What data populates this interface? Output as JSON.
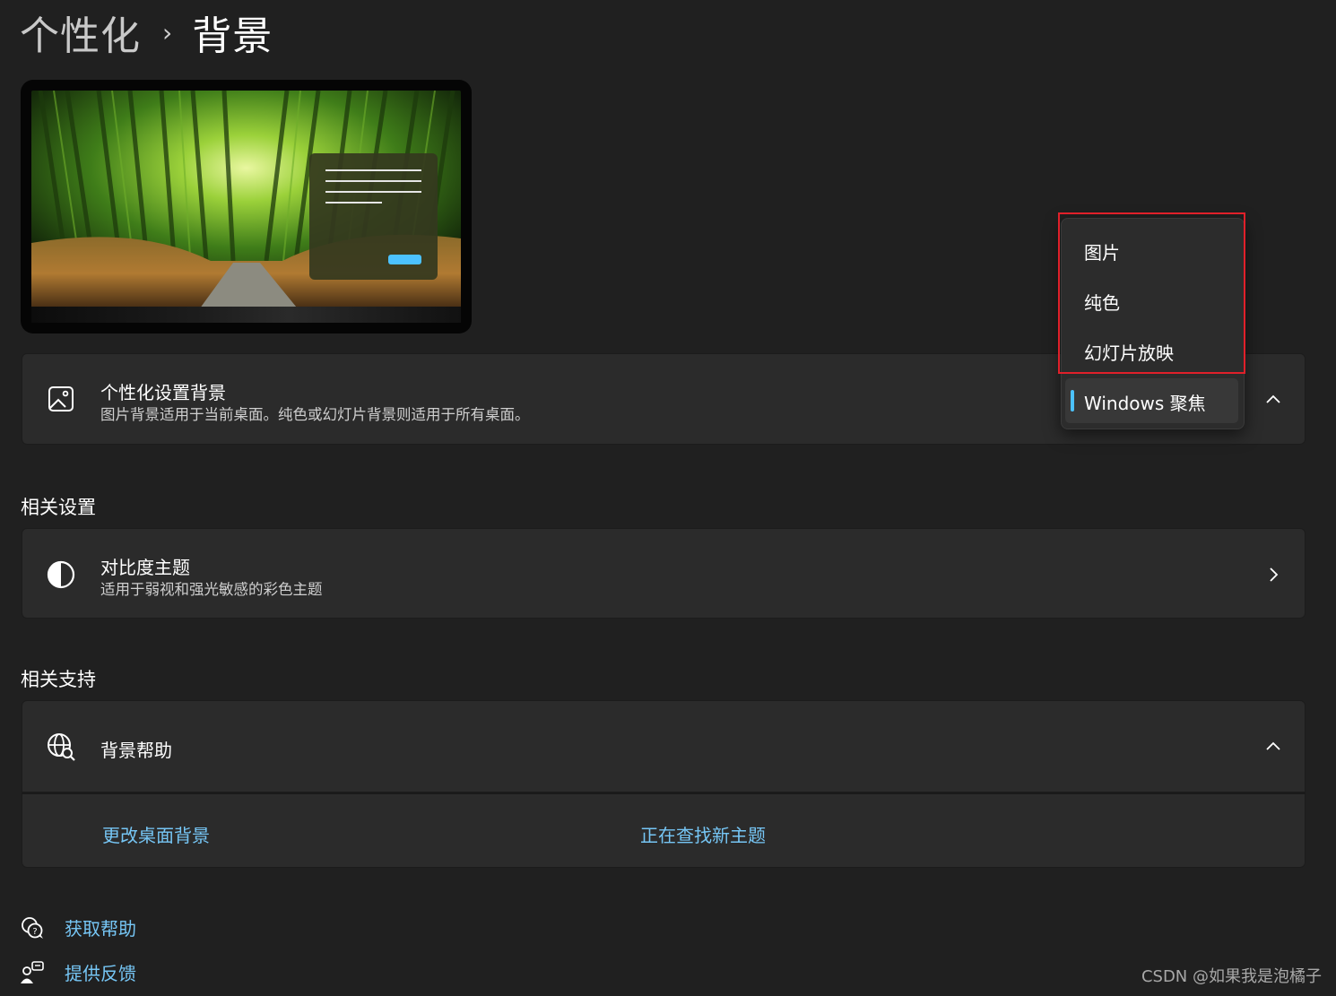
{
  "breadcrumb": {
    "parent": "个性化",
    "separator": "›",
    "current": "背景"
  },
  "background_card": {
    "title": "个性化设置背景",
    "subtitle": "图片背景适用于当前桌面。纯色或幻灯片背景则适用于所有桌面。",
    "icon": "image-icon"
  },
  "dropdown": {
    "options": [
      "图片",
      "纯色",
      "幻灯片放映",
      "Windows 聚焦"
    ],
    "selected": "Windows 聚焦"
  },
  "related_settings": {
    "heading": "相关设置",
    "contrast_theme": {
      "title": "对比度主题",
      "subtitle": "适用于弱视和强光敏感的彩色主题",
      "icon": "contrast-icon"
    }
  },
  "related_support": {
    "heading": "相关支持",
    "help_card": {
      "title": "背景帮助",
      "icon": "globe-search-icon",
      "links": [
        "更改桌面背景",
        "正在查找新主题"
      ]
    }
  },
  "footer": {
    "get_help": "获取帮助",
    "feedback": "提供反馈"
  },
  "watermark": "CSDN @如果我是泡橘子",
  "colors": {
    "accent": "#4cc2ff",
    "link": "#76c6f5",
    "highlight": "#e0202a",
    "background": "#202020",
    "card": "#2b2b2b"
  }
}
